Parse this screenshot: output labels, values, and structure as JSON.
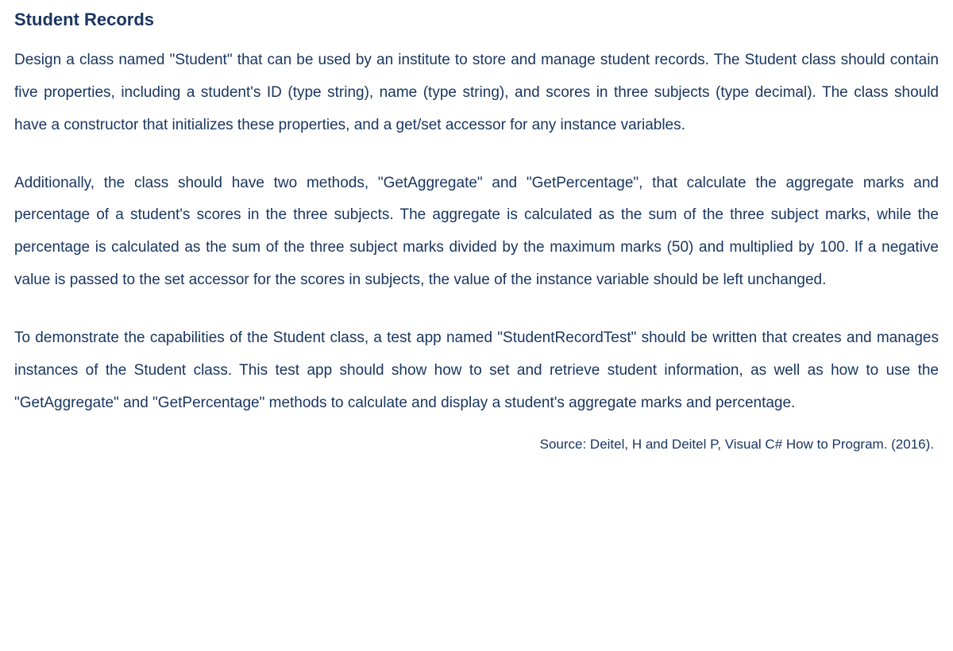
{
  "title": "Student Records",
  "paragraphs": [
    "Design a class named \"Student\" that can be used by an institute to store and manage student records. The Student class should contain five properties, including a student's ID (type string), name (type string), and scores in three subjects (type decimal). The class should have a constructor that initializes these properties, and a get/set accessor for any instance variables.",
    "Additionally, the class should have two methods, \"GetAggregate\" and \"GetPercentage\", that calculate the aggregate marks and percentage of a student's scores in the three subjects. The aggregate is calculated as the sum of the three subject marks, while the percentage is calculated as the sum of the three subject marks divided by the maximum marks (50) and multiplied by 100. If a negative value is passed to the set accessor for the scores in subjects, the value of the instance variable should be left unchanged.",
    "To demonstrate the capabilities of the Student class, a test app named \"StudentRecordTest\" should be written that creates and manages instances of the Student class. This test app should show how to set and retrieve student information, as well as how to use the \"GetAggregate\" and \"GetPercentage\" methods to calculate and display a student's aggregate marks and percentage."
  ],
  "citation": "Source: Deitel, H and Deitel P, Visual C# How to Program. (2016)."
}
